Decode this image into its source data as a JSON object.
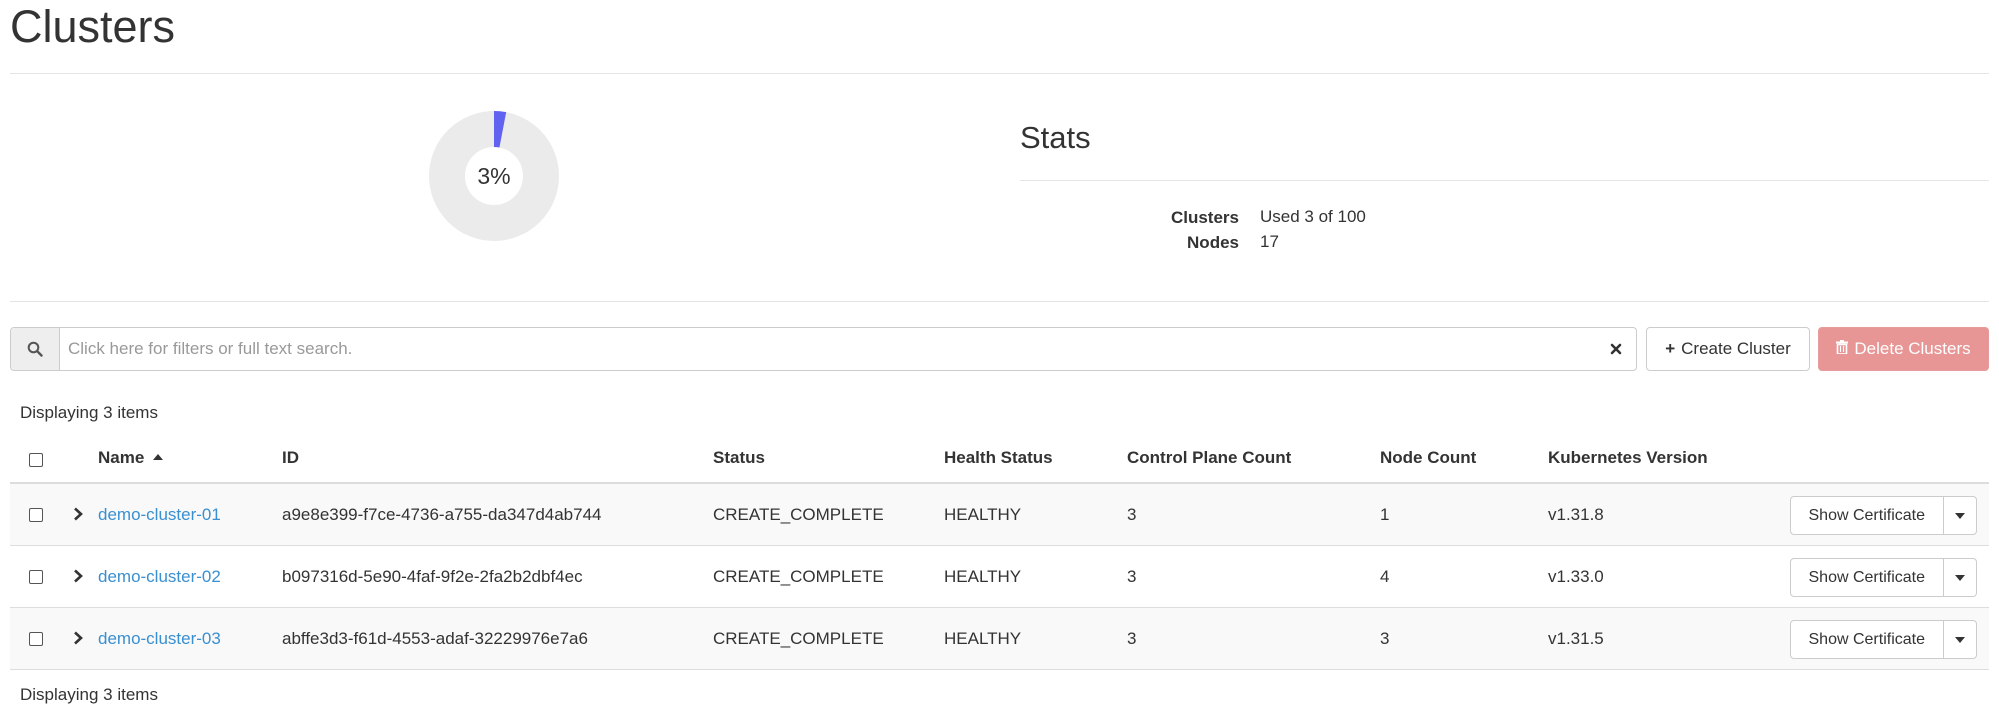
{
  "page": {
    "title": "Clusters"
  },
  "usage_chart": {
    "percent": 3,
    "label": "3%",
    "used_color": "#6262f0",
    "track_color": "#ebebeb"
  },
  "stats": {
    "title": "Stats",
    "items": [
      {
        "label": "Clusters",
        "value": "Used 3 of 100"
      },
      {
        "label": "Nodes",
        "value": "17"
      }
    ]
  },
  "toolbar": {
    "search_placeholder": "Click here for filters or full text search.",
    "search_icon": "search-icon",
    "clear_icon": "close-icon",
    "create_label": "Create Cluster",
    "create_icon": "+",
    "delete_label": "Delete Clusters",
    "delete_icon": "trash-icon"
  },
  "count_top": "Displaying 3 items",
  "count_bottom": "Displaying 3 items",
  "table": {
    "headers": {
      "name": "Name",
      "id": "ID",
      "status": "Status",
      "health": "Health Status",
      "cp_count": "Control Plane Count",
      "node_count": "Node Count",
      "k8s_version": "Kubernetes Version"
    },
    "rows": [
      {
        "name": "demo-cluster-01",
        "id": "a9e8e399-f7ce-4736-a755-da347d4ab744",
        "status": "CREATE_COMPLETE",
        "health": "HEALTHY",
        "cp_count": "3",
        "node_count": "1",
        "k8s_version": "v1.31.8",
        "action": "Show Certificate"
      },
      {
        "name": "demo-cluster-02",
        "id": "b097316d-5e90-4faf-9f2e-2fa2b2dbf4ec",
        "status": "CREATE_COMPLETE",
        "health": "HEALTHY",
        "cp_count": "3",
        "node_count": "4",
        "k8s_version": "v1.33.0",
        "action": "Show Certificate"
      },
      {
        "name": "demo-cluster-03",
        "id": "abffe3d3-f61d-4553-adaf-32229976e7a6",
        "status": "CREATE_COMPLETE",
        "health": "HEALTHY",
        "cp_count": "3",
        "node_count": "3",
        "k8s_version": "v1.31.5",
        "action": "Show Certificate"
      }
    ]
  }
}
